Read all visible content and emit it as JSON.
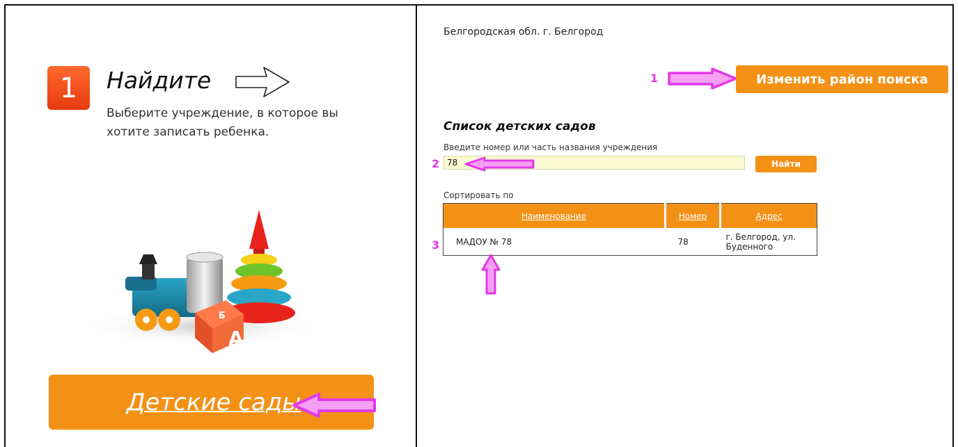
{
  "left_panel": {
    "step_number": "1",
    "step_title": "Найдите",
    "step_description": "Выберите учреждение, в которое вы хотите записать ребенка.",
    "kindergartens_button": "Детские сады"
  },
  "right_panel": {
    "region": "Белгородская обл. г. Белгород",
    "change_area_button": "Изменить район поиска",
    "list_title": "Список детских садов",
    "search_label": "Введите номер или часть названия учреждения",
    "search_value": "78",
    "find_button": "Найти",
    "sort_label": "Сортировать по",
    "table": {
      "headers": [
        "Наименование",
        "Номер",
        "Адрес"
      ],
      "rows": [
        {
          "name": "МАДОУ № 78",
          "number": "78",
          "address": "г. Белгород, ул. Буденного"
        }
      ]
    }
  },
  "annotations": {
    "a1": "1",
    "a2": "2",
    "a3": "3"
  },
  "colors": {
    "accent": "#f39117",
    "annotation": "#e23ae8",
    "input_bg": "#fbfbd2"
  },
  "icons": [
    "arrow-outline-icon",
    "toys-illustration",
    "pink-arrow-icon"
  ]
}
